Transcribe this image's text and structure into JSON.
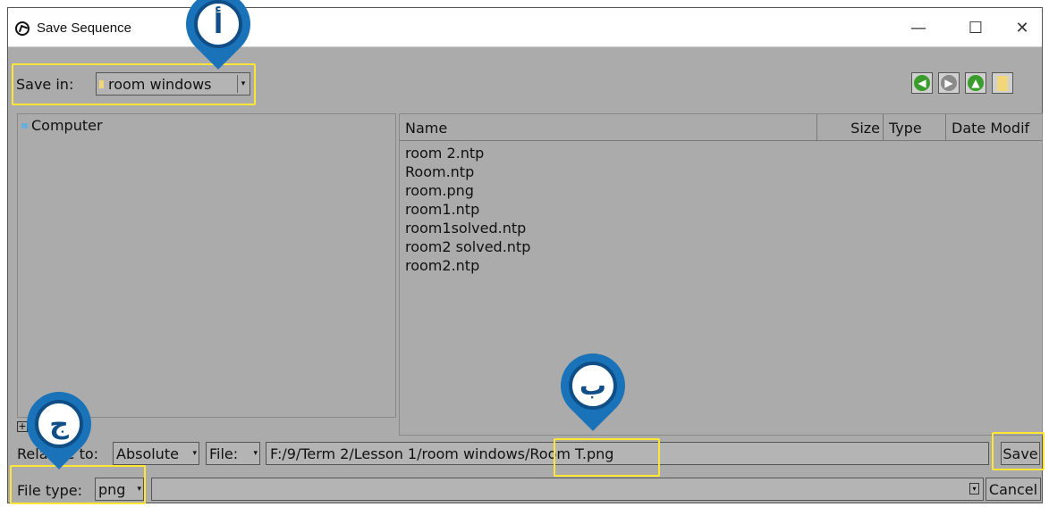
{
  "window": {
    "title": "Save Sequence",
    "controls": {
      "minimize": "—",
      "maximize": "☐",
      "close": "✕"
    }
  },
  "save_in": {
    "label": "Save in:",
    "value": "room windows"
  },
  "nav_buttons": [
    {
      "icon": "back-arrow-icon",
      "glyph": "◀",
      "color": "#3a9c2c"
    },
    {
      "icon": "forward-arrow-icon",
      "glyph": "▶",
      "color": "#8a8a8a"
    },
    {
      "icon": "up-arrow-icon",
      "glyph": "▲",
      "color": "#3a9c2c"
    },
    {
      "icon": "new-folder-icon",
      "color": "#f1d779"
    }
  ],
  "tree": {
    "items": [
      "Computer"
    ]
  },
  "file_list": {
    "columns": [
      "Name",
      "Size",
      "Type",
      "Date Modif"
    ],
    "files": [
      "room 2.ntp",
      "Room.ntp",
      "room.png",
      "room1.ntp",
      "room1solved.ntp",
      "room2 solved.ntp",
      "room2.ntp"
    ]
  },
  "relative_row": {
    "label": "Relative to:",
    "relative_value": "Absolute",
    "file_combo": "File:",
    "path_prefix": "F:/9/Term 2/Lesson 1/room windows/",
    "filename": "Room T.png",
    "save_button": "Save"
  },
  "filetype_row": {
    "label": "File type:",
    "value": "png",
    "filter_value": "",
    "cancel_button": "Cancel"
  },
  "callouts": {
    "a": "أ",
    "b": "ب",
    "c": "ج"
  },
  "colors": {
    "highlight": "#ffe536",
    "pin": "#1a73b8",
    "pin_border": "#0f4e86",
    "window_bg": "#ababab"
  }
}
